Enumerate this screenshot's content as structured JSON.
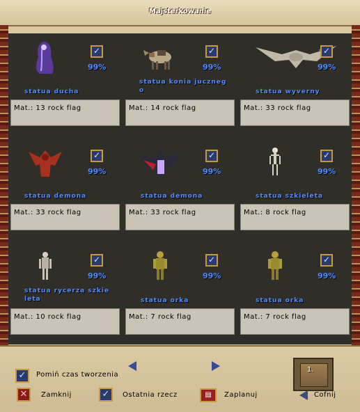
{
  "window": {
    "title": "Majsterkowanie"
  },
  "items": [
    {
      "name": "statua ducha",
      "pct": "99%",
      "mat": "Mat.: 13 rock flag",
      "icon": "ghost-statue-icon"
    },
    {
      "name": "statua konia juczneg\no",
      "pct": "99%",
      "mat": "Mat.: 14 rock flag",
      "icon": "pack-horse-statue-icon"
    },
    {
      "name": "statua wyverny",
      "pct": "99%",
      "mat": "Mat.: 33 rock flag",
      "icon": "wyvern-statue-icon"
    },
    {
      "name": "statua demona",
      "pct": "99%",
      "mat": "Mat.: 33 rock flag",
      "icon": "red-demon-statue-icon"
    },
    {
      "name": "statua demona",
      "pct": "99%",
      "mat": "Mat.: 33 rock flag",
      "icon": "winged-demon-statue-icon"
    },
    {
      "name": "statua szkieleta",
      "pct": "99%",
      "mat": "Mat.: 8 rock flag",
      "icon": "skeleton-statue-icon"
    },
    {
      "name": "statua rycerza szkie\nleta",
      "pct": "99%",
      "mat": "Mat.: 10 rock flag",
      "icon": "skeleton-knight-statue-icon"
    },
    {
      "name": "statua orka",
      "pct": "99%",
      "mat": "Mat.: 7 rock flag",
      "icon": "orc-statue-icon"
    },
    {
      "name": "statua orka",
      "pct": "99%",
      "mat": "Mat.: 7 rock flag",
      "icon": "orc-statue-icon"
    }
  ],
  "bottom": {
    "skip_time_label": "Pomiń czas tworzenia",
    "close_label": "Zamknij",
    "last_item_label": "Ostatnia rzecz",
    "plan_label": "Zaplanuj",
    "back_label": "Cofnij",
    "selected_count": "1."
  },
  "colors": {
    "name_text": "#4f8cff",
    "grid_bg": "#2f2e29",
    "mat_bg": "#c9c4b6"
  }
}
